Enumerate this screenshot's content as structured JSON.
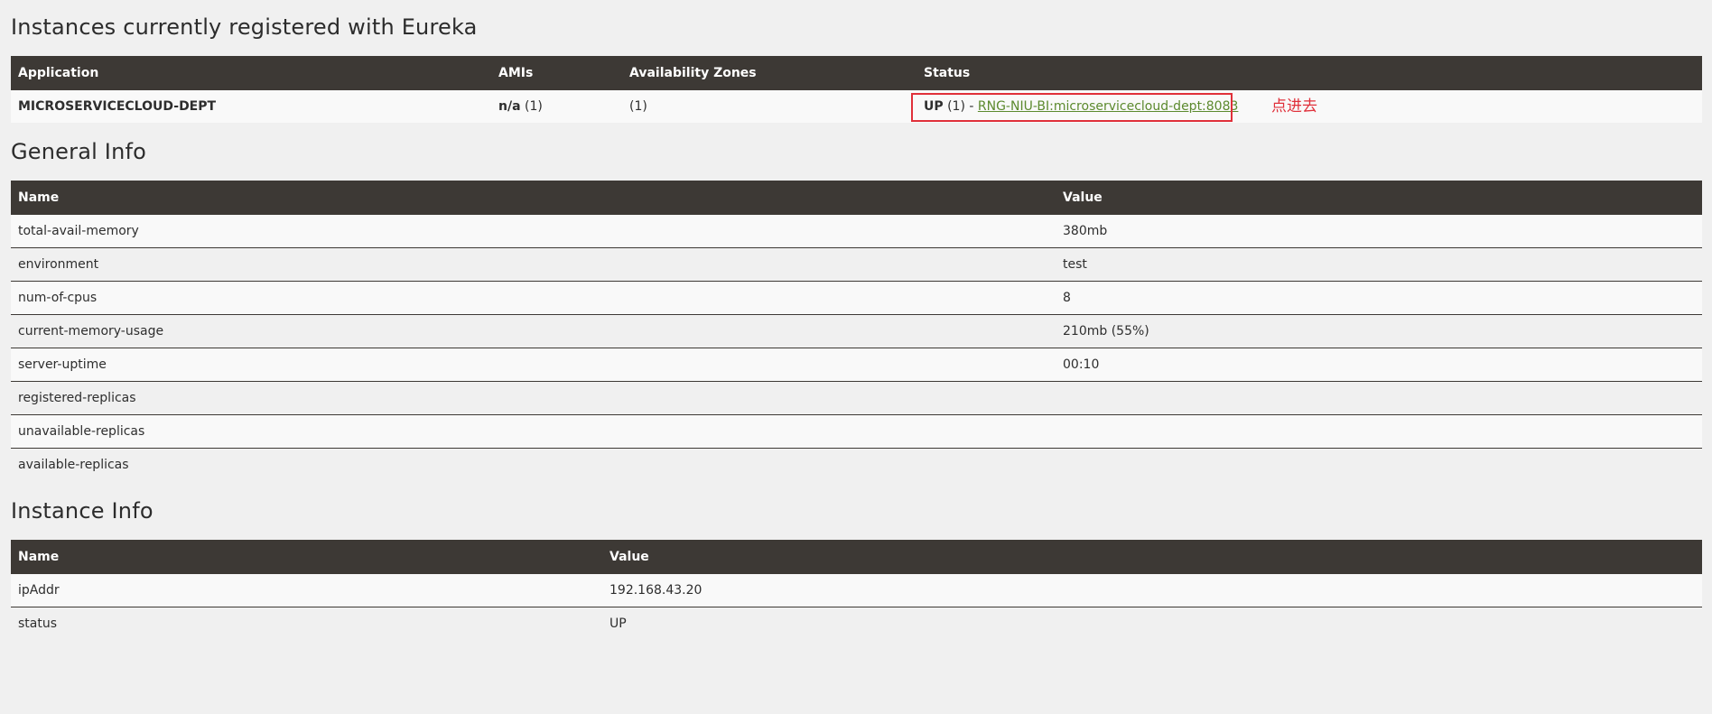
{
  "instances": {
    "title": "Instances currently registered with Eureka",
    "columns": [
      "Application",
      "AMIs",
      "Availability Zones",
      "Status"
    ],
    "row": {
      "application": "MICROSERVICECLOUD-DEPT",
      "amis_bold": "n/a",
      "amis_count": " (1)",
      "zones": "(1)",
      "status_bold": "UP",
      "status_count": " (1) - ",
      "status_link": "RNG-NIU-BI:microservicecloud-dept:8083"
    },
    "annotation": "点进去"
  },
  "general": {
    "title": "General Info",
    "columns": [
      "Name",
      "Value"
    ],
    "rows": [
      {
        "name": "total-avail-memory",
        "value": "380mb"
      },
      {
        "name": "environment",
        "value": "test"
      },
      {
        "name": "num-of-cpus",
        "value": "8"
      },
      {
        "name": "current-memory-usage",
        "value": "210mb (55%)"
      },
      {
        "name": "server-uptime",
        "value": "00:10"
      },
      {
        "name": "registered-replicas",
        "value": ""
      },
      {
        "name": "unavailable-replicas",
        "value": ""
      },
      {
        "name": "available-replicas",
        "value": ""
      }
    ]
  },
  "instance_info": {
    "title": "Instance Info",
    "columns": [
      "Name",
      "Value"
    ],
    "rows": [
      {
        "name": "ipAddr",
        "value": "192.168.43.20"
      },
      {
        "name": "status",
        "value": "UP"
      }
    ]
  },
  "colors": {
    "header_bg": "#3d3935",
    "link": "#5c8a2e",
    "highlight": "#e0303a"
  }
}
